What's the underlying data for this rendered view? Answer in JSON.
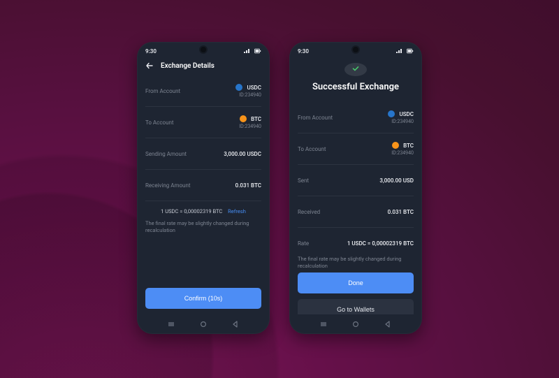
{
  "status_time": "9:30",
  "left": {
    "title": "Exchange Details",
    "rows": {
      "from_label": "From Account",
      "from_coin": "USDC",
      "from_id": "ID:234940",
      "to_label": "To Account",
      "to_coin": "BTC",
      "to_id": "ID:234940",
      "sending_label": "Sending Amount",
      "sending_value": "3,000.00 USDC",
      "receiving_label": "Receiving Amount",
      "receiving_value": "0.031 BTC"
    },
    "rate_line": "1 USDC = 0,00002319 BTC",
    "refresh": "Refresh",
    "rate_note": "The final rate may be slightly changed during recalculation",
    "confirm": "Confirm (10s)"
  },
  "right": {
    "title": "Successful Exchange",
    "rows": {
      "from_label": "From Account",
      "from_coin": "USDC",
      "from_id": "ID:234940",
      "to_label": "To Account",
      "to_coin": "BTC",
      "to_id": "ID:234940",
      "sent_label": "Sent",
      "sent_value": "3,000.00 USD",
      "received_label": "Received",
      "received_value": "0.031 BTC",
      "rate_label": "Rate",
      "rate_value": "1 USDC = 0,00002319 BTC"
    },
    "rate_note": "The final rate may be slightly changed during recalculation",
    "done": "Done",
    "go_wallets": "Go to Wallets"
  },
  "colors": {
    "accent": "#4d8df5",
    "usdc": "#2775ca",
    "btc": "#f7931a",
    "panel": "#1e2532"
  }
}
